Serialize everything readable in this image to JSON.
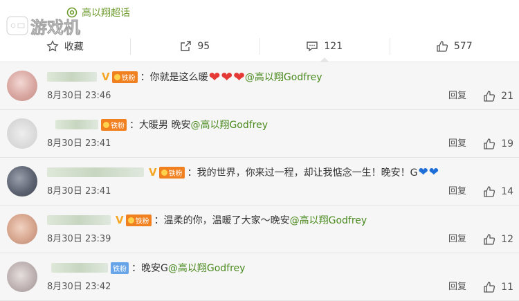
{
  "topic": {
    "label": "高以翔超话"
  },
  "actions": [
    {
      "label": "收藏",
      "count": ""
    },
    {
      "label": "",
      "count": "95"
    },
    {
      "label": "",
      "count": "121"
    },
    {
      "label": "",
      "count": "577"
    }
  ],
  "comments": [
    {
      "badge": "铁粉",
      "text": "：你就是这么暖",
      "mention": "@高以翔Godfrey",
      "time": "8月30日 23:46",
      "reply": "回复",
      "likes": "21"
    },
    {
      "badge": "铁粉",
      "text": "：大暖男 晚安",
      "mention": "@高以翔Godfrey",
      "time": "8月30日 23:41",
      "reply": "回复",
      "likes": "19"
    },
    {
      "badge": "铁粉",
      "text": "：我的世界，你来过一程，却让我惦念一生！晚安！G",
      "mention": "",
      "time": "8月30日 23:41",
      "reply": "回复",
      "likes": "14"
    },
    {
      "badge": "铁粉",
      "text": "：温柔的你，温暖了大家～晚安",
      "mention": "@高以翔Godfrey",
      "time": "8月30日 23:39",
      "reply": "回复",
      "likes": "12"
    },
    {
      "badge": "铁粉",
      "text": "：晚安G",
      "mention": "@高以翔Godfrey",
      "time": "8月30日 23:42",
      "reply": "回复",
      "likes": "11"
    }
  ],
  "watermark": "游戏机"
}
